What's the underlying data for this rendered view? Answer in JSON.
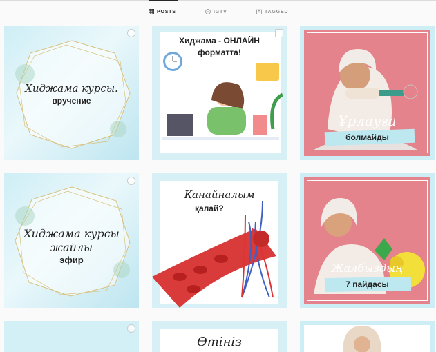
{
  "tabs": [
    {
      "label": "POSTS",
      "icon": "grid-icon",
      "active": true
    },
    {
      "label": "IGTV",
      "icon": "igtv-icon",
      "active": false
    },
    {
      "label": "TAGGED",
      "icon": "tagged-icon",
      "active": false
    }
  ],
  "posts": [
    {
      "line1": "Хиджама курсы.",
      "line2": "вручение"
    },
    {
      "line1": "Хиджама - ОНЛАЙН",
      "line2": "форматта!"
    },
    {
      "line1": "Ұрлауға",
      "line2": "болмайды"
    },
    {
      "line1": "Хиджама курсы",
      "line2": "жайлы",
      "line3": "эфир"
    },
    {
      "line1": "Қанайналым",
      "line2": "қалай?"
    },
    {
      "line1": "Жалбыздың",
      "line2": "7 пайдасы"
    },
    {
      "line1": ""
    },
    {
      "line1": "Өтініз"
    },
    {
      "line1": ""
    }
  ],
  "colors": {
    "accent": "#262626",
    "muted": "#8e8e8e",
    "pink": "#e4838b",
    "mint": "#d6f0f4"
  }
}
